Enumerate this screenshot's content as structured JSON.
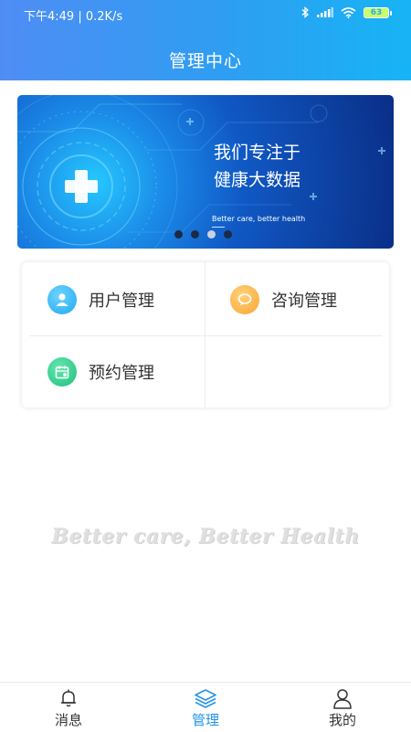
{
  "status_bar": {
    "time": "下午4:49",
    "speed": "0.2K/s",
    "battery": "63"
  },
  "header": {
    "title": "管理中心"
  },
  "banner": {
    "line1": "我们专注于",
    "line2": "健康大数据",
    "subtitle": "Better care,  better health",
    "slides": 4,
    "active_slide": 3
  },
  "menu": {
    "items": [
      {
        "label": "用户管理",
        "icon": "user-icon",
        "color": "#29b6f6"
      },
      {
        "label": "咨询管理",
        "icon": "chat-bubble-icon",
        "color": "#fdb44b"
      },
      {
        "label": "预约管理",
        "icon": "calendar-icon",
        "color": "#2ecc8f"
      }
    ]
  },
  "slogan": "Better care, Better Health",
  "tabs": [
    {
      "label": "消息",
      "icon": "bell-icon",
      "active": false
    },
    {
      "label": "管理",
      "icon": "layers-icon",
      "active": true
    },
    {
      "label": "我的",
      "icon": "person-icon",
      "active": false
    }
  ],
  "colors": {
    "accent": "#2494e8",
    "header_start": "#4f8df5",
    "header_end": "#17b4f5"
  }
}
